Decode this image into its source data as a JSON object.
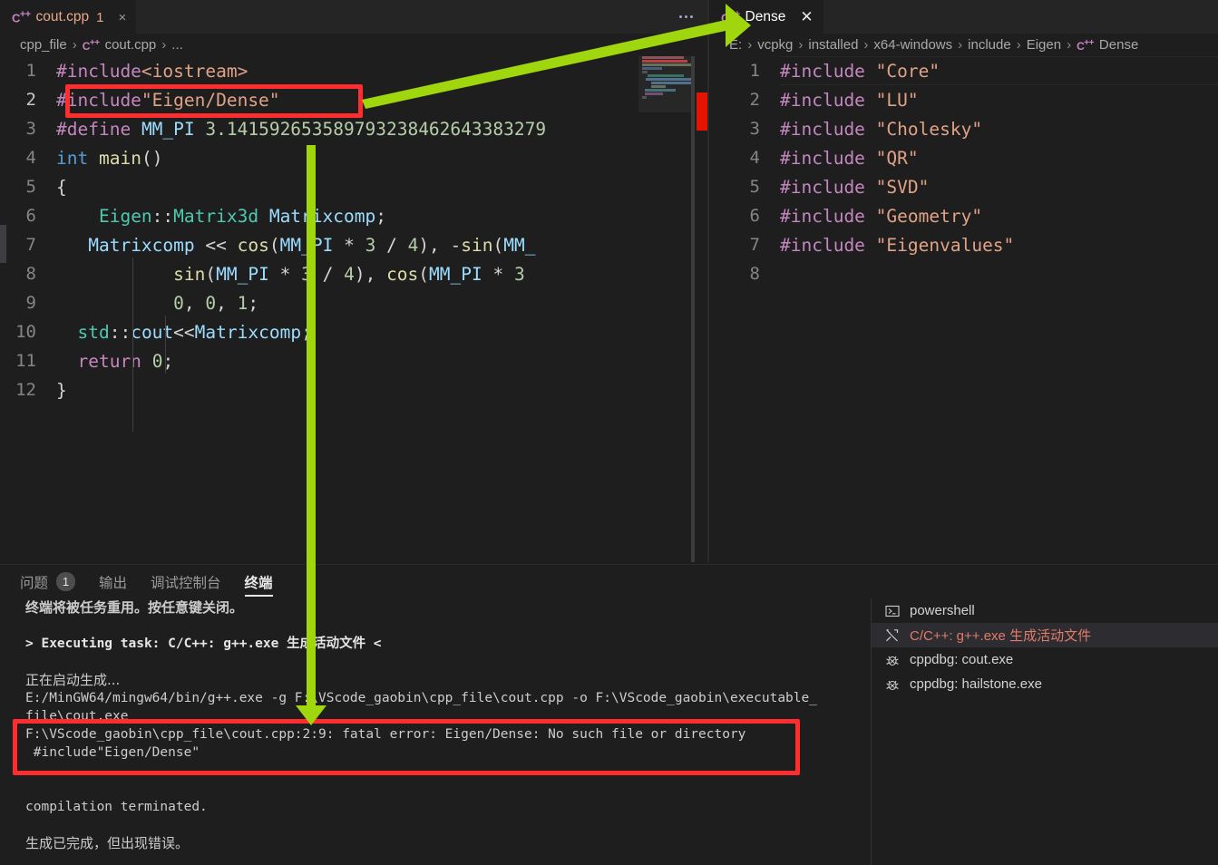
{
  "app": "vscode",
  "colors": {
    "accent_green_arrow": "#9fd60e",
    "annotation_red": "#ff2d2d",
    "editor_bg": "#1e1e1e",
    "tabbar_bg": "#252526",
    "error_red": "#e07b6a"
  },
  "left_editor": {
    "tab": {
      "icon": "cpp-icon",
      "label": "cout.cpp",
      "problem_count": "1",
      "close": "×"
    },
    "more_actions": "...",
    "breadcrumb": [
      "cpp_file",
      "cout.cpp",
      "..."
    ],
    "lines": [
      {
        "n": "1",
        "text": "#include<iostream>"
      },
      {
        "n": "2",
        "text": "#include\"Eigen/Dense\""
      },
      {
        "n": "3",
        "text": "#define MM_PI 3.141592653589793238462643383279"
      },
      {
        "n": "4",
        "text": "int main()"
      },
      {
        "n": "5",
        "text": "{"
      },
      {
        "n": "6",
        "text": "    Eigen::Matrix3d Matrixcomp;"
      },
      {
        "n": "7",
        "text": "    Matrixcomp << cos(MM_PI * 3 / 4), -sin(MM_"
      },
      {
        "n": "8",
        "text": "            sin(MM_PI * 3 / 4), cos(MM_PI * 3"
      },
      {
        "n": "9",
        "text": "            0, 0, 1;"
      },
      {
        "n": "10",
        "text": "  std::cout<<Matrixcomp;"
      },
      {
        "n": "11",
        "text": "  return 0;"
      },
      {
        "n": "12",
        "text": "}"
      }
    ]
  },
  "right_editor": {
    "tab": {
      "icon": "cpp-icon",
      "label": "Dense",
      "close": "✕"
    },
    "breadcrumb": [
      "E:",
      "vcpkg",
      "installed",
      "x64-windows",
      "include",
      "Eigen",
      "Dense"
    ],
    "lines": [
      {
        "n": "1",
        "include": "#include",
        "value": "\"Core\""
      },
      {
        "n": "2",
        "include": "#include",
        "value": "\"LU\""
      },
      {
        "n": "3",
        "include": "#include",
        "value": "\"Cholesky\""
      },
      {
        "n": "4",
        "include": "#include",
        "value": "\"QR\""
      },
      {
        "n": "5",
        "include": "#include",
        "value": "\"SVD\""
      },
      {
        "n": "6",
        "include": "#include",
        "value": "\"Geometry\""
      },
      {
        "n": "7",
        "include": "#include",
        "value": "\"Eigenvalues\""
      },
      {
        "n": "8",
        "include": "",
        "value": ""
      }
    ]
  },
  "panel": {
    "tabs": [
      {
        "label": "问题",
        "count": "1",
        "active": false
      },
      {
        "label": "输出",
        "count": "",
        "active": false
      },
      {
        "label": "调试控制台",
        "count": "",
        "active": false
      },
      {
        "label": "终端",
        "count": "",
        "active": true
      }
    ],
    "terminal_lines": [
      {
        "text": "终端将被任务重用。按任意键关闭。",
        "style": "cjk-bold"
      },
      {
        "text": "",
        "style": "gap"
      },
      {
        "text": "> Executing task: C/C++: g++.exe 生成活动文件 <",
        "style": "bold"
      },
      {
        "text": "",
        "style": "gap"
      },
      {
        "text": "正在启动生成...",
        "style": "cjk"
      },
      {
        "text": "E:/MinGW64/mingw64/bin/g++.exe -g F:\\VScode_gaobin\\cpp_file\\cout.cpp -o F:\\VScode_gaobin\\executable_",
        "style": "plain"
      },
      {
        "text": "file\\cout.exe",
        "style": "plain"
      },
      {
        "text": "F:\\VScode_gaobin\\cpp_file\\cout.cpp:2:9: fatal error: Eigen/Dense: No such file or directory",
        "style": "plain"
      },
      {
        "text": " #include\"Eigen/Dense\"",
        "style": "plain"
      },
      {
        "text": "",
        "style": "gap"
      },
      {
        "text": "compilation terminated.",
        "style": "plain"
      },
      {
        "text": "生成已完成，但出现错误。",
        "style": "cjk"
      }
    ],
    "terminal_list": [
      {
        "icon": "terminal-icon",
        "label": "powershell",
        "selected": false
      },
      {
        "icon": "tools-icon",
        "label": "C/C++: g++.exe 生成活动文件",
        "selected": true
      },
      {
        "icon": "debug-bug-icon",
        "label": "cppdbg: cout.exe",
        "selected": false
      },
      {
        "icon": "debug-bug-icon",
        "label": "cppdbg: hailstone.exe",
        "selected": false
      }
    ]
  },
  "annotations": {
    "highlight_include_line": "#include\"Eigen/Dense\"",
    "highlight_error_text": "F:\\VScode_gaobin\\cpp_file\\cout.cpp:2:9: fatal error: Eigen/Dense: No such file or directory",
    "arrow_from": "line-2-include-statement",
    "arrow_to": "dense-tab"
  }
}
